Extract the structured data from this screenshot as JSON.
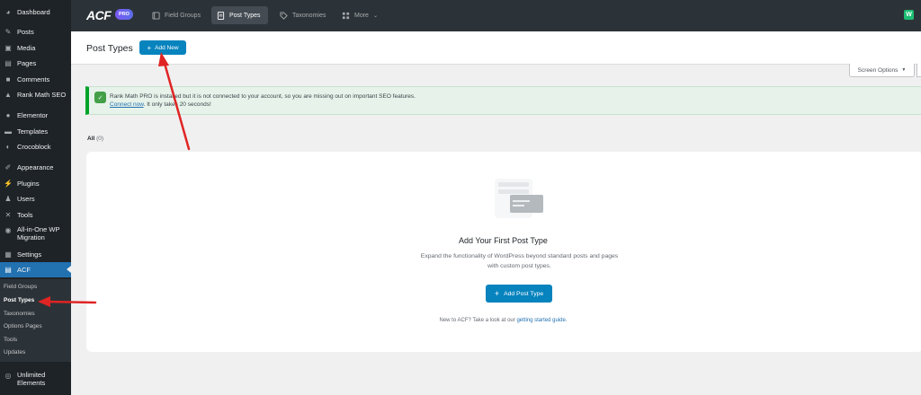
{
  "sidebar": {
    "items": [
      {
        "label": "Dashboard",
        "icon": "dashboard-icon",
        "glyph": "◕"
      },
      {
        "label": "Posts",
        "icon": "pin-icon",
        "glyph": "✎"
      },
      {
        "label": "Media",
        "icon": "media-icon",
        "glyph": "▣"
      },
      {
        "label": "Pages",
        "icon": "pages-icon",
        "glyph": "▤"
      },
      {
        "label": "Comments",
        "icon": "comments-icon",
        "glyph": "■"
      },
      {
        "label": "Rank Math SEO",
        "icon": "rank-math-icon",
        "glyph": "▲"
      },
      {
        "label": "Elementor",
        "icon": "elementor-icon",
        "glyph": "●"
      },
      {
        "label": "Templates",
        "icon": "folder-icon",
        "glyph": "▬"
      },
      {
        "label": "Crocoblock",
        "icon": "crocoblock-icon",
        "glyph": "◐"
      },
      {
        "label": "Appearance",
        "icon": "brush-icon",
        "glyph": "✐"
      },
      {
        "label": "Plugins",
        "icon": "plugin-icon",
        "glyph": "⚡"
      },
      {
        "label": "Users",
        "icon": "user-icon",
        "glyph": "♟"
      },
      {
        "label": "Tools",
        "icon": "wrench-icon",
        "glyph": "✕"
      },
      {
        "label": "All-in-One WP",
        "label2": "Migration",
        "icon": "migration-icon",
        "glyph": "◉"
      },
      {
        "label": "Settings",
        "icon": "settings-icon",
        "glyph": "▦"
      },
      {
        "label": "ACF",
        "icon": "acf-icon",
        "glyph": "▤"
      },
      {
        "label": "Unlimited",
        "label2": "Elements",
        "icon": "unlimited-elements-icon",
        "glyph": "◎"
      }
    ],
    "submenu": [
      "Field Groups",
      "Post Types",
      "Taxonomies",
      "Options Pages",
      "Tools",
      "Updates"
    ]
  },
  "topbar": {
    "logo": "ACF",
    "badge": "PRO",
    "tabs": [
      {
        "label": "Field Groups",
        "icon": "field-groups-icon"
      },
      {
        "label": "Post Types",
        "icon": "post-types-icon"
      },
      {
        "label": "Taxonomies",
        "icon": "tag-icon"
      },
      {
        "label": "More",
        "icon": "more-icon"
      }
    ],
    "right_logo": "W"
  },
  "header": {
    "title": "Post Types",
    "add_new": "Add New",
    "screen_options": "Screen Options"
  },
  "notice": {
    "line1": "Rank Math PRO is installed but it is not connected to your account, so you are missing out on important SEO features.",
    "link": "Connect now",
    "line2_rest": ". It only takes 20 seconds!"
  },
  "filter": {
    "label": "All",
    "count": "(0)"
  },
  "empty_state": {
    "title": "Add Your First Post Type",
    "description": "Expand the functionality of WordPress beyond standard posts and pages with custom post types.",
    "button": "Add Post Type",
    "footer_text": "New to ACF? Take a look at our",
    "footer_link": "getting started guide",
    "footer_end": "."
  },
  "colors": {
    "sidebar_bg": "#1d2327",
    "active": "#2271b1",
    "button": "#0783be",
    "annotation_arrow": "#e02424",
    "notice_bg": "#e7f3ea"
  }
}
